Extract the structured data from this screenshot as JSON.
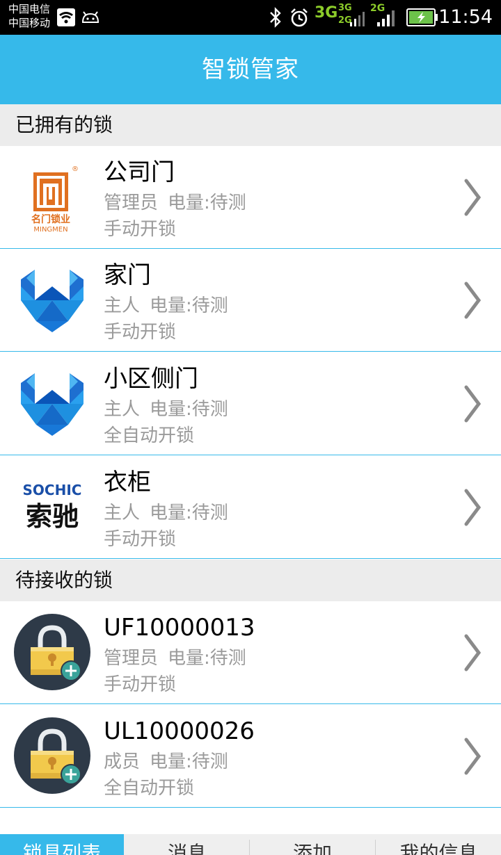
{
  "status_bar": {
    "carrier_1": "中国电信",
    "carrier_2": "中国移动",
    "network_1": "3G",
    "network_2a": "3G",
    "network_2b": "2G",
    "network_3": "2G",
    "time": "11:54"
  },
  "header": {
    "title": "智锁管家"
  },
  "owned_section": {
    "title": "已拥有的锁"
  },
  "owned_locks": [
    {
      "name": "公司门",
      "role": "管理员",
      "battery": "电量:待测",
      "mode": "手动开锁",
      "logo": "mingmen-logo"
    },
    {
      "name": "家门",
      "role": "主人",
      "battery": "电量:待测",
      "mode": "手动开锁",
      "logo": "blue-triangle-logo"
    },
    {
      "name": "小区侧门",
      "role": "主人",
      "battery": "电量:待测",
      "mode": "全自动开锁",
      "logo": "blue-triangle-logo"
    },
    {
      "name": "衣柜",
      "role": "主人",
      "battery": "电量:待测",
      "mode": "手动开锁",
      "logo": "sochic-logo"
    }
  ],
  "pending_section": {
    "title": "待接收的锁"
  },
  "pending_locks": [
    {
      "name": "UF10000013",
      "role": "管理员",
      "battery": "电量:待测",
      "mode": "手动开锁",
      "logo": "padlock-add-icon"
    },
    {
      "name": "UL10000026",
      "role": "成员",
      "battery": "电量:待测",
      "mode": "全自动开锁",
      "logo": "padlock-add-icon"
    }
  ],
  "logos": {
    "mingmen_cn": "名门锁业",
    "mingmen_en": "MINGMEN",
    "mingmen_reg": "®",
    "sochic_en": "SOCHIC",
    "sochic_cn": "索驰"
  },
  "tabs": [
    {
      "label": "锁具列表",
      "active": true
    },
    {
      "label": "消息",
      "active": false
    },
    {
      "label": "添加",
      "active": false
    },
    {
      "label": "我的信息",
      "active": false
    }
  ],
  "colors": {
    "accent": "#36b9ea",
    "section_bg": "#ececec",
    "meta_text": "#9a9a9a",
    "padlock_bg": "#2e3a48",
    "padlock_body": "#f2c94c",
    "add_badge": "#3aa39a"
  }
}
